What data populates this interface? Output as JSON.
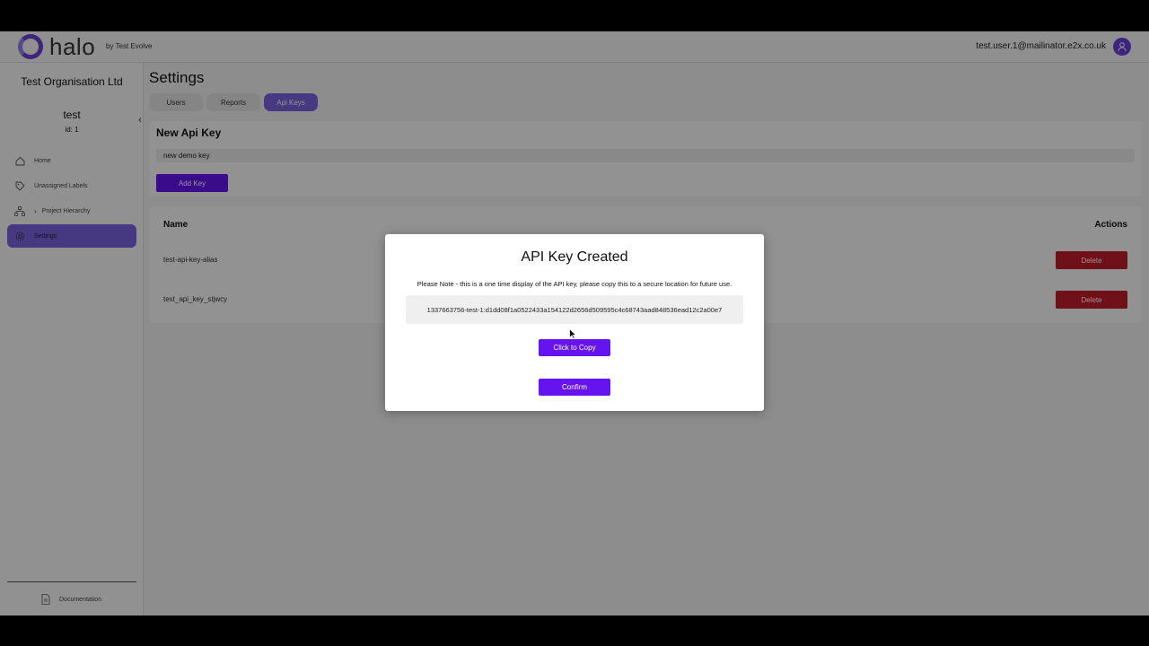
{
  "header": {
    "logo_text": "halo",
    "logo_by": "by Test Evolve",
    "user_email": "test.user.1@mailinator.e2x.co.uk",
    "avatar_icon": "user-icon"
  },
  "sidebar": {
    "org_name": "Test Organisation Ltd",
    "project_name": "test",
    "project_id": "id: 1",
    "collapse_icon": "chevron-left-icon",
    "items": [
      {
        "label": "Home",
        "icon": "home-icon",
        "active": false
      },
      {
        "label": "Unassigned Labels",
        "icon": "tag-icon",
        "active": false
      },
      {
        "label": "Project Hierarchy",
        "icon": "hierarchy-icon",
        "active": false
      },
      {
        "label": "Settings",
        "icon": "gear-icon",
        "active": true
      }
    ],
    "documentation": {
      "label": "Documentation",
      "icon": "document-icon"
    }
  },
  "main": {
    "title": "Settings",
    "tabs": [
      {
        "label": "Users",
        "active": false
      },
      {
        "label": "Reports",
        "active": false
      },
      {
        "label": "Api Keys",
        "active": true
      }
    ],
    "new_key": {
      "heading": "New Api Key",
      "input_value": "new demo key",
      "add_label": "Add Key"
    },
    "table": {
      "col_name": "Name",
      "col_actions": "Actions",
      "rows": [
        {
          "name": "test-api-key-alias",
          "action": "Delete"
        },
        {
          "name": "test_api_key_stjwcy",
          "action": "Delete"
        }
      ]
    }
  },
  "modal": {
    "title": "API Key Created",
    "note": "Please Note - this is a one time display of the API key, please copy this to a secure location for future use.",
    "key_value": "1337663756-test-1:d1dd08f1a0522433a154122d2656d509595c4c68743aad848536ead12c2a00e7",
    "copy_label": "Click to Copy",
    "confirm_label": "Confirm"
  },
  "colors": {
    "accent": "#6514f0",
    "active_nav": "#7a61e0",
    "danger": "#c11d2b"
  }
}
